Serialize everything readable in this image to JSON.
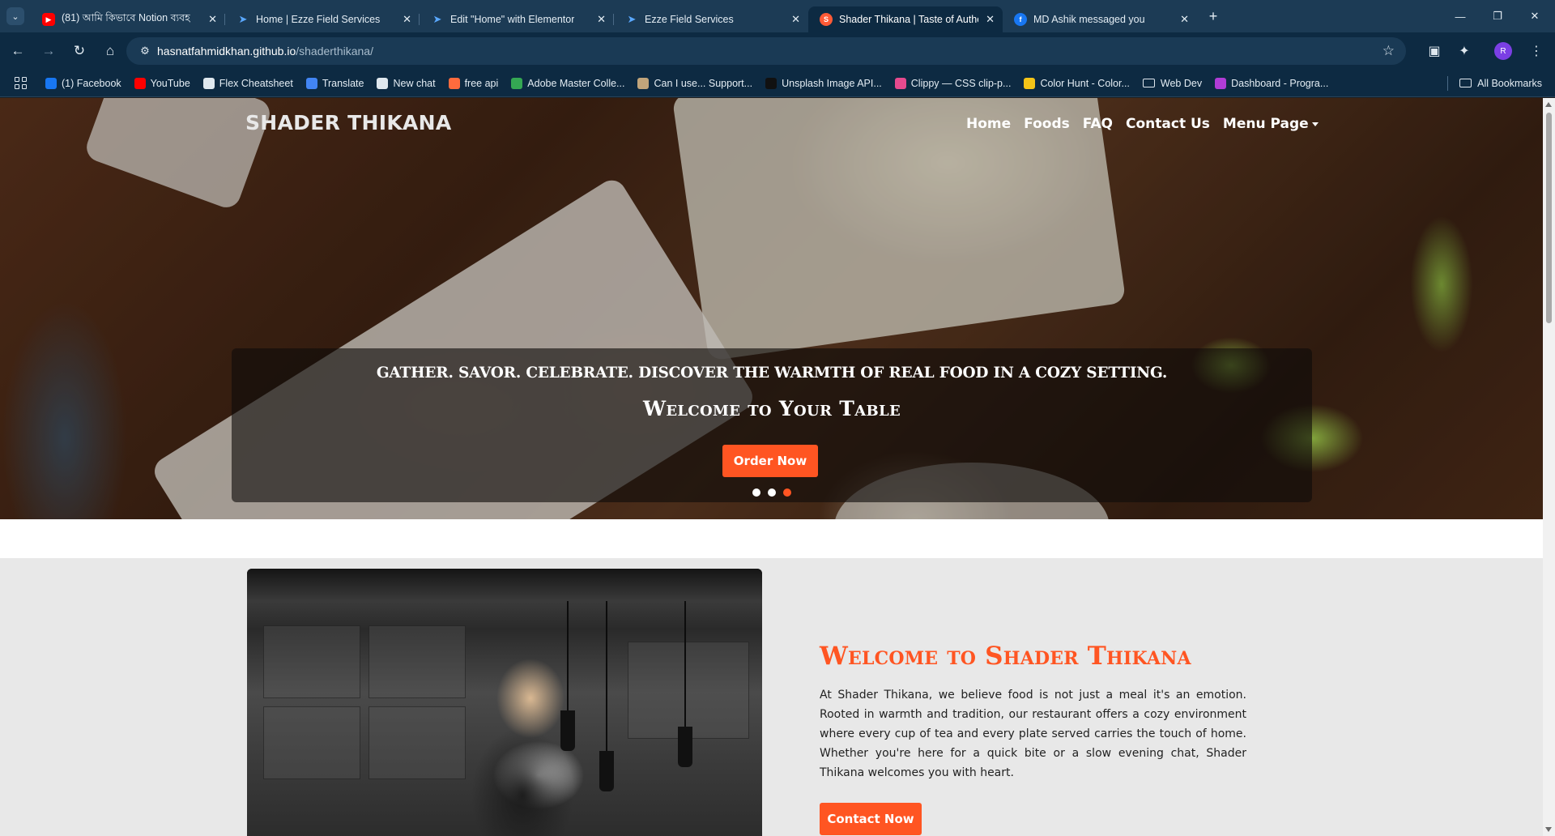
{
  "browser": {
    "tabs": [
      {
        "title": "(81) আমি কিভাবে Notion ব্যবহ",
        "favicon": "youtube-icon"
      },
      {
        "title": "Home | Ezze Field Services",
        "favicon": "wordpress-icon"
      },
      {
        "title": "Edit \"Home\" with Elementor",
        "favicon": "wordpress-icon"
      },
      {
        "title": "Ezze Field Services",
        "favicon": "wordpress-icon"
      },
      {
        "title": "Shader Thikana | Taste of Authe",
        "favicon": "site-icon",
        "active": true
      },
      {
        "title": "MD Ashik messaged you",
        "favicon": "facebook-icon"
      }
    ],
    "address": {
      "host": "hasnatfahmidkhan.github.io",
      "path": "/shaderthikana/"
    },
    "profile_initial": "R",
    "bookmarks": [
      {
        "label": "(1) Facebook",
        "icon": "facebook-icon",
        "color": "#1877f2"
      },
      {
        "label": "YouTube",
        "icon": "youtube-icon",
        "color": "#ff0000"
      },
      {
        "label": "Flex Cheatsheet",
        "icon": "circle-icon",
        "color": "#dfe8ef"
      },
      {
        "label": "Translate",
        "icon": "translate-icon",
        "color": "#4285f4"
      },
      {
        "label": "New chat",
        "icon": "chatgpt-icon",
        "color": "#dfe8ef"
      },
      {
        "label": "free api",
        "icon": "api-icon",
        "color": "#ff6b3d"
      },
      {
        "label": "Adobe Master Colle...",
        "icon": "adobe-icon",
        "color": "#34a853"
      },
      {
        "label": "Can I use... Support...",
        "icon": "caniuse-icon",
        "color": "#c1a57b"
      },
      {
        "label": "Unsplash Image API...",
        "icon": "unsplash-icon",
        "color": "#111111"
      },
      {
        "label": "Clippy — CSS clip-p...",
        "icon": "clippy-icon",
        "color": "#e64a8e"
      },
      {
        "label": "Color Hunt - Color...",
        "icon": "colorhunt-icon",
        "color": "#f5c518"
      },
      {
        "label": "Web Dev",
        "icon": "folder-icon",
        "color": "#dfe8ef"
      },
      {
        "label": "Dashboard - Progra...",
        "icon": "programming-hero-icon",
        "color": "#b03cd6"
      }
    ],
    "all_bookmarks": "All Bookmarks"
  },
  "site": {
    "logo": "SHADER THIKANA",
    "nav": [
      "Home",
      "Foods",
      "FAQ",
      "Contact Us",
      "Menu Page"
    ],
    "hero": {
      "tagline": "GATHER. SAVOR. CELEBRATE. DISCOVER THE WARMTH OF REAL FOOD IN A COZY SETTING.",
      "title": "Welcome to Your Table",
      "button": "Order Now",
      "slides": 3,
      "active_slide": 3
    },
    "about": {
      "title": "Welcome to Shader Thikana",
      "text": "At Shader Thikana, we believe food is not just a meal it's an emotion. Rooted in warmth and tradition, our restaurant offers a cozy environment where every cup of tea and every plate served carries the touch of home. Whether you're here for a quick bite or a slow evening chat, Shader Thikana welcomes you with heart.",
      "button": "Contact Now"
    },
    "colors": {
      "accent": "#ff5522",
      "section_bg": "#e8e8e8"
    }
  }
}
